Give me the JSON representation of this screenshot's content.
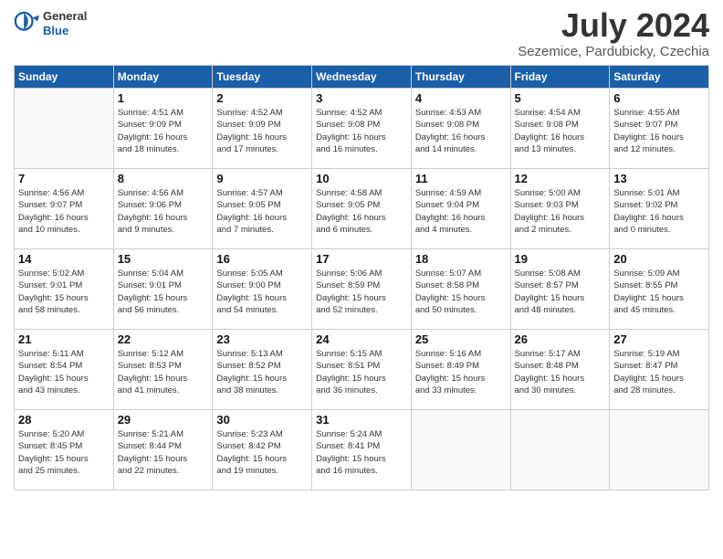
{
  "header": {
    "logo": {
      "general": "General",
      "blue": "Blue"
    },
    "title": "July 2024",
    "location": "Sezemice, Pardubicky, Czechia"
  },
  "weekdays": [
    "Sunday",
    "Monday",
    "Tuesday",
    "Wednesday",
    "Thursday",
    "Friday",
    "Saturday"
  ],
  "weeks": [
    [
      {
        "day": "",
        "info": ""
      },
      {
        "day": "1",
        "info": "Sunrise: 4:51 AM\nSunset: 9:09 PM\nDaylight: 16 hours\nand 18 minutes."
      },
      {
        "day": "2",
        "info": "Sunrise: 4:52 AM\nSunset: 9:09 PM\nDaylight: 16 hours\nand 17 minutes."
      },
      {
        "day": "3",
        "info": "Sunrise: 4:52 AM\nSunset: 9:08 PM\nDaylight: 16 hours\nand 16 minutes."
      },
      {
        "day": "4",
        "info": "Sunrise: 4:53 AM\nSunset: 9:08 PM\nDaylight: 16 hours\nand 14 minutes."
      },
      {
        "day": "5",
        "info": "Sunrise: 4:54 AM\nSunset: 9:08 PM\nDaylight: 16 hours\nand 13 minutes."
      },
      {
        "day": "6",
        "info": "Sunrise: 4:55 AM\nSunset: 9:07 PM\nDaylight: 16 hours\nand 12 minutes."
      }
    ],
    [
      {
        "day": "7",
        "info": "Sunrise: 4:56 AM\nSunset: 9:07 PM\nDaylight: 16 hours\nand 10 minutes."
      },
      {
        "day": "8",
        "info": "Sunrise: 4:56 AM\nSunset: 9:06 PM\nDaylight: 16 hours\nand 9 minutes."
      },
      {
        "day": "9",
        "info": "Sunrise: 4:57 AM\nSunset: 9:05 PM\nDaylight: 16 hours\nand 7 minutes."
      },
      {
        "day": "10",
        "info": "Sunrise: 4:58 AM\nSunset: 9:05 PM\nDaylight: 16 hours\nand 6 minutes."
      },
      {
        "day": "11",
        "info": "Sunrise: 4:59 AM\nSunset: 9:04 PM\nDaylight: 16 hours\nand 4 minutes."
      },
      {
        "day": "12",
        "info": "Sunrise: 5:00 AM\nSunset: 9:03 PM\nDaylight: 16 hours\nand 2 minutes."
      },
      {
        "day": "13",
        "info": "Sunrise: 5:01 AM\nSunset: 9:02 PM\nDaylight: 16 hours\nand 0 minutes."
      }
    ],
    [
      {
        "day": "14",
        "info": "Sunrise: 5:02 AM\nSunset: 9:01 PM\nDaylight: 15 hours\nand 58 minutes."
      },
      {
        "day": "15",
        "info": "Sunrise: 5:04 AM\nSunset: 9:01 PM\nDaylight: 15 hours\nand 56 minutes."
      },
      {
        "day": "16",
        "info": "Sunrise: 5:05 AM\nSunset: 9:00 PM\nDaylight: 15 hours\nand 54 minutes."
      },
      {
        "day": "17",
        "info": "Sunrise: 5:06 AM\nSunset: 8:59 PM\nDaylight: 15 hours\nand 52 minutes."
      },
      {
        "day": "18",
        "info": "Sunrise: 5:07 AM\nSunset: 8:58 PM\nDaylight: 15 hours\nand 50 minutes."
      },
      {
        "day": "19",
        "info": "Sunrise: 5:08 AM\nSunset: 8:57 PM\nDaylight: 15 hours\nand 48 minutes."
      },
      {
        "day": "20",
        "info": "Sunrise: 5:09 AM\nSunset: 8:55 PM\nDaylight: 15 hours\nand 45 minutes."
      }
    ],
    [
      {
        "day": "21",
        "info": "Sunrise: 5:11 AM\nSunset: 8:54 PM\nDaylight: 15 hours\nand 43 minutes."
      },
      {
        "day": "22",
        "info": "Sunrise: 5:12 AM\nSunset: 8:53 PM\nDaylight: 15 hours\nand 41 minutes."
      },
      {
        "day": "23",
        "info": "Sunrise: 5:13 AM\nSunset: 8:52 PM\nDaylight: 15 hours\nand 38 minutes."
      },
      {
        "day": "24",
        "info": "Sunrise: 5:15 AM\nSunset: 8:51 PM\nDaylight: 15 hours\nand 36 minutes."
      },
      {
        "day": "25",
        "info": "Sunrise: 5:16 AM\nSunset: 8:49 PM\nDaylight: 15 hours\nand 33 minutes."
      },
      {
        "day": "26",
        "info": "Sunrise: 5:17 AM\nSunset: 8:48 PM\nDaylight: 15 hours\nand 30 minutes."
      },
      {
        "day": "27",
        "info": "Sunrise: 5:19 AM\nSunset: 8:47 PM\nDaylight: 15 hours\nand 28 minutes."
      }
    ],
    [
      {
        "day": "28",
        "info": "Sunrise: 5:20 AM\nSunset: 8:45 PM\nDaylight: 15 hours\nand 25 minutes."
      },
      {
        "day": "29",
        "info": "Sunrise: 5:21 AM\nSunset: 8:44 PM\nDaylight: 15 hours\nand 22 minutes."
      },
      {
        "day": "30",
        "info": "Sunrise: 5:23 AM\nSunset: 8:42 PM\nDaylight: 15 hours\nand 19 minutes."
      },
      {
        "day": "31",
        "info": "Sunrise: 5:24 AM\nSunset: 8:41 PM\nDaylight: 15 hours\nand 16 minutes."
      },
      {
        "day": "",
        "info": ""
      },
      {
        "day": "",
        "info": ""
      },
      {
        "day": "",
        "info": ""
      }
    ]
  ]
}
